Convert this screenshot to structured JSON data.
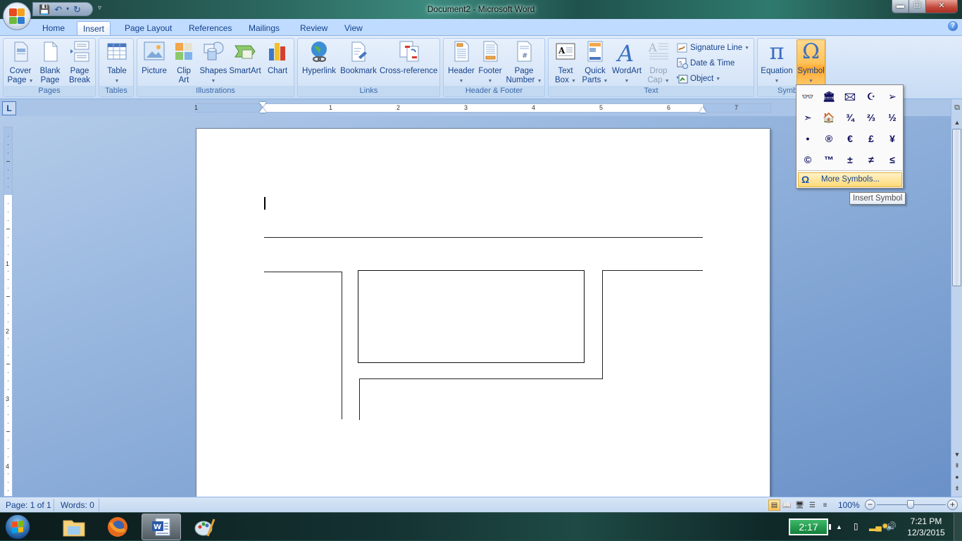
{
  "window": {
    "title": "Document2 - Microsoft Word",
    "controls": {
      "minimize": "minimize",
      "restore": "restore",
      "close": "close"
    }
  },
  "quick_access": {
    "save": "save-icon",
    "undo": "undo-icon",
    "redo": "redo-icon",
    "customize": "customize-icon"
  },
  "tabs": [
    {
      "label": "Home"
    },
    {
      "label": "Insert",
      "active": true
    },
    {
      "label": "Page Layout"
    },
    {
      "label": "References"
    },
    {
      "label": "Mailings"
    },
    {
      "label": "Review"
    },
    {
      "label": "View"
    }
  ],
  "ribbon": {
    "groups": {
      "pages": {
        "label": "Pages",
        "buttons": [
          {
            "label1": "Cover",
            "label2": "Page",
            "dropdown": true
          },
          {
            "label1": "Blank",
            "label2": "Page"
          },
          {
            "label1": "Page",
            "label2": "Break"
          }
        ]
      },
      "tables": {
        "label": "Tables",
        "buttons": [
          {
            "label1": "Table",
            "dropdown": true
          }
        ]
      },
      "illustrations": {
        "label": "Illustrations",
        "buttons": [
          {
            "label1": "Picture"
          },
          {
            "label1": "Clip",
            "label2": "Art"
          },
          {
            "label1": "Shapes",
            "dropdown": true
          },
          {
            "label1": "SmartArt"
          },
          {
            "label1": "Chart"
          }
        ]
      },
      "links": {
        "label": "Links",
        "buttons": [
          {
            "label1": "Hyperlink"
          },
          {
            "label1": "Bookmark"
          },
          {
            "label1": "Cross-reference"
          }
        ]
      },
      "header_footer": {
        "label": "Header & Footer",
        "buttons": [
          {
            "label1": "Header",
            "dropdown": true
          },
          {
            "label1": "Footer",
            "dropdown": true
          },
          {
            "label1": "Page",
            "label2": "Number",
            "dropdown": true
          }
        ]
      },
      "text": {
        "label": "Text",
        "buttons": [
          {
            "label1": "Text",
            "label2": "Box",
            "dropdown": true
          },
          {
            "label1": "Quick",
            "label2": "Parts",
            "dropdown": true
          },
          {
            "label1": "WordArt",
            "dropdown": true
          },
          {
            "label1": "Drop",
            "label2": "Cap",
            "dropdown": true,
            "disabled": true
          }
        ],
        "small_buttons": [
          {
            "label": "Signature Line",
            "dropdown": true
          },
          {
            "label": "Date & Time"
          },
          {
            "label": "Object",
            "dropdown": true
          }
        ]
      },
      "symbols": {
        "label": "Symbols",
        "visible_label": "Symb",
        "buttons": [
          {
            "label1": "Equation",
            "dropdown": true
          },
          {
            "label1": "Symbol",
            "dropdown": true,
            "active": true
          }
        ]
      }
    }
  },
  "symbol_gallery": {
    "symbols": [
      "👓",
      "🏛",
      "🖂",
      "☪",
      "➢",
      "➣",
      "🏠",
      "¾",
      "⅔",
      "½",
      "•",
      "®",
      "€",
      "£",
      "¥",
      "©",
      "™",
      "±",
      "≠",
      "≤"
    ],
    "more_label": "More Symbols...",
    "tooltip": "Insert Symbol"
  },
  "ruler": {
    "horizontal_numbers": [
      "1",
      "1",
      "2",
      "3",
      "4",
      "5",
      "6",
      "7"
    ],
    "vertical_numbers": [
      "1",
      "2",
      "3",
      "4"
    ]
  },
  "status_bar": {
    "page": "Page: 1 of 1",
    "words": "Words: 0",
    "zoom": "100%",
    "zoom_level_percent": 100,
    "view_buttons": [
      "print-layout",
      "full-screen-reading",
      "web-layout",
      "outline",
      "draft"
    ]
  },
  "taskbar": {
    "apps": [
      "Windows Explorer",
      "Firefox",
      "Microsoft Word",
      "Paint"
    ],
    "active_app": "Microsoft Word",
    "battery": "2:17",
    "time": "7:21 PM",
    "date": "12/3/2015"
  },
  "colors": {
    "accent": "#ffc25a",
    "ribbon": "#bfdbff",
    "text": "#15428b"
  }
}
